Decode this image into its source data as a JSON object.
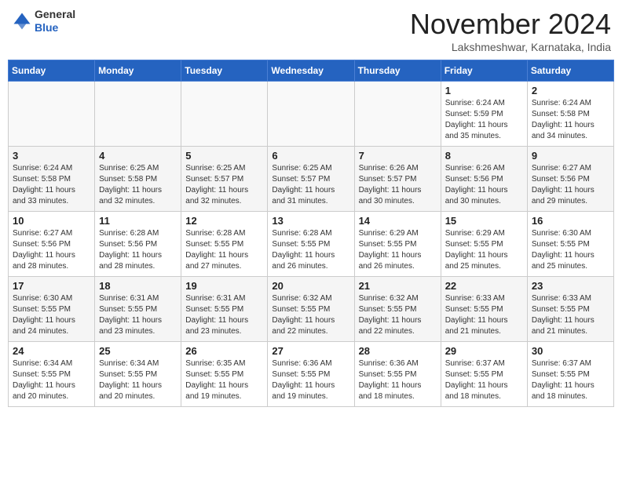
{
  "logo": {
    "general": "General",
    "blue": "Blue"
  },
  "header": {
    "month": "November 2024",
    "location": "Lakshmeshwar, Karnataka, India"
  },
  "weekdays": [
    "Sunday",
    "Monday",
    "Tuesday",
    "Wednesday",
    "Thursday",
    "Friday",
    "Saturday"
  ],
  "weeks": [
    [
      {
        "day": "",
        "info": ""
      },
      {
        "day": "",
        "info": ""
      },
      {
        "day": "",
        "info": ""
      },
      {
        "day": "",
        "info": ""
      },
      {
        "day": "",
        "info": ""
      },
      {
        "day": "1",
        "info": "Sunrise: 6:24 AM\nSunset: 5:59 PM\nDaylight: 11 hours\nand 35 minutes."
      },
      {
        "day": "2",
        "info": "Sunrise: 6:24 AM\nSunset: 5:58 PM\nDaylight: 11 hours\nand 34 minutes."
      }
    ],
    [
      {
        "day": "3",
        "info": "Sunrise: 6:24 AM\nSunset: 5:58 PM\nDaylight: 11 hours\nand 33 minutes."
      },
      {
        "day": "4",
        "info": "Sunrise: 6:25 AM\nSunset: 5:58 PM\nDaylight: 11 hours\nand 32 minutes."
      },
      {
        "day": "5",
        "info": "Sunrise: 6:25 AM\nSunset: 5:57 PM\nDaylight: 11 hours\nand 32 minutes."
      },
      {
        "day": "6",
        "info": "Sunrise: 6:25 AM\nSunset: 5:57 PM\nDaylight: 11 hours\nand 31 minutes."
      },
      {
        "day": "7",
        "info": "Sunrise: 6:26 AM\nSunset: 5:57 PM\nDaylight: 11 hours\nand 30 minutes."
      },
      {
        "day": "8",
        "info": "Sunrise: 6:26 AM\nSunset: 5:56 PM\nDaylight: 11 hours\nand 30 minutes."
      },
      {
        "day": "9",
        "info": "Sunrise: 6:27 AM\nSunset: 5:56 PM\nDaylight: 11 hours\nand 29 minutes."
      }
    ],
    [
      {
        "day": "10",
        "info": "Sunrise: 6:27 AM\nSunset: 5:56 PM\nDaylight: 11 hours\nand 28 minutes."
      },
      {
        "day": "11",
        "info": "Sunrise: 6:28 AM\nSunset: 5:56 PM\nDaylight: 11 hours\nand 28 minutes."
      },
      {
        "day": "12",
        "info": "Sunrise: 6:28 AM\nSunset: 5:55 PM\nDaylight: 11 hours\nand 27 minutes."
      },
      {
        "day": "13",
        "info": "Sunrise: 6:28 AM\nSunset: 5:55 PM\nDaylight: 11 hours\nand 26 minutes."
      },
      {
        "day": "14",
        "info": "Sunrise: 6:29 AM\nSunset: 5:55 PM\nDaylight: 11 hours\nand 26 minutes."
      },
      {
        "day": "15",
        "info": "Sunrise: 6:29 AM\nSunset: 5:55 PM\nDaylight: 11 hours\nand 25 minutes."
      },
      {
        "day": "16",
        "info": "Sunrise: 6:30 AM\nSunset: 5:55 PM\nDaylight: 11 hours\nand 25 minutes."
      }
    ],
    [
      {
        "day": "17",
        "info": "Sunrise: 6:30 AM\nSunset: 5:55 PM\nDaylight: 11 hours\nand 24 minutes."
      },
      {
        "day": "18",
        "info": "Sunrise: 6:31 AM\nSunset: 5:55 PM\nDaylight: 11 hours\nand 23 minutes."
      },
      {
        "day": "19",
        "info": "Sunrise: 6:31 AM\nSunset: 5:55 PM\nDaylight: 11 hours\nand 23 minutes."
      },
      {
        "day": "20",
        "info": "Sunrise: 6:32 AM\nSunset: 5:55 PM\nDaylight: 11 hours\nand 22 minutes."
      },
      {
        "day": "21",
        "info": "Sunrise: 6:32 AM\nSunset: 5:55 PM\nDaylight: 11 hours\nand 22 minutes."
      },
      {
        "day": "22",
        "info": "Sunrise: 6:33 AM\nSunset: 5:55 PM\nDaylight: 11 hours\nand 21 minutes."
      },
      {
        "day": "23",
        "info": "Sunrise: 6:33 AM\nSunset: 5:55 PM\nDaylight: 11 hours\nand 21 minutes."
      }
    ],
    [
      {
        "day": "24",
        "info": "Sunrise: 6:34 AM\nSunset: 5:55 PM\nDaylight: 11 hours\nand 20 minutes."
      },
      {
        "day": "25",
        "info": "Sunrise: 6:34 AM\nSunset: 5:55 PM\nDaylight: 11 hours\nand 20 minutes."
      },
      {
        "day": "26",
        "info": "Sunrise: 6:35 AM\nSunset: 5:55 PM\nDaylight: 11 hours\nand 19 minutes."
      },
      {
        "day": "27",
        "info": "Sunrise: 6:36 AM\nSunset: 5:55 PM\nDaylight: 11 hours\nand 19 minutes."
      },
      {
        "day": "28",
        "info": "Sunrise: 6:36 AM\nSunset: 5:55 PM\nDaylight: 11 hours\nand 18 minutes."
      },
      {
        "day": "29",
        "info": "Sunrise: 6:37 AM\nSunset: 5:55 PM\nDaylight: 11 hours\nand 18 minutes."
      },
      {
        "day": "30",
        "info": "Sunrise: 6:37 AM\nSunset: 5:55 PM\nDaylight: 11 hours\nand 18 minutes."
      }
    ]
  ]
}
